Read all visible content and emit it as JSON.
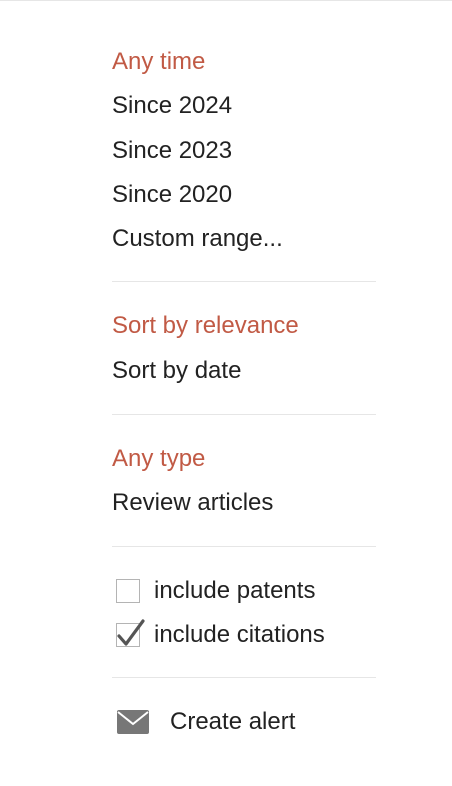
{
  "time_filter": {
    "items": [
      {
        "label": "Any time",
        "selected": true
      },
      {
        "label": "Since 2024",
        "selected": false
      },
      {
        "label": "Since 2023",
        "selected": false
      },
      {
        "label": "Since 2020",
        "selected": false
      },
      {
        "label": "Custom range...",
        "selected": false
      }
    ]
  },
  "sort": {
    "items": [
      {
        "label": "Sort by relevance",
        "selected": true
      },
      {
        "label": "Sort by date",
        "selected": false
      }
    ]
  },
  "type_filter": {
    "items": [
      {
        "label": "Any type",
        "selected": true
      },
      {
        "label": "Review articles",
        "selected": false
      }
    ]
  },
  "options": {
    "include_patents": {
      "label": "include patents",
      "checked": false
    },
    "include_citations": {
      "label": "include citations",
      "checked": true
    }
  },
  "alert": {
    "label": "Create alert",
    "icon": "envelope-icon"
  },
  "colors": {
    "selected": "#c15a45",
    "text": "#222222",
    "divider": "#e6e6e6",
    "icon": "#777777"
  }
}
